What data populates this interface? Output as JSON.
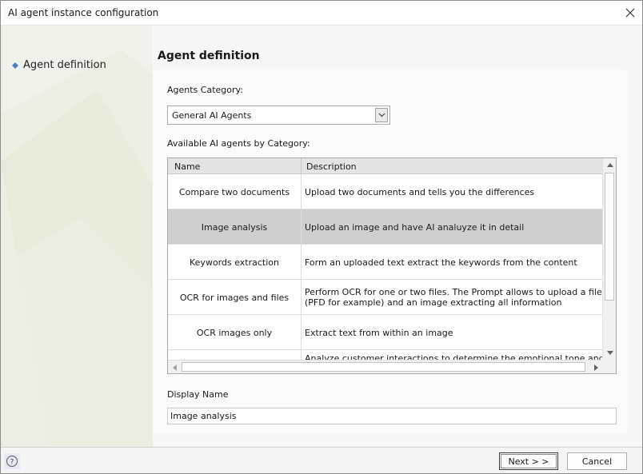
{
  "window": {
    "title": "AI agent instance configuration",
    "close_icon": "close-icon"
  },
  "sidebar": {
    "items": [
      {
        "label": "Agent definition",
        "icon": "diamond-bullet-icon",
        "active": true
      }
    ]
  },
  "main": {
    "heading": "Agent definition",
    "category_label": "Agents Category:",
    "category_value": "General AI Agents",
    "available_label": "Available AI agents by Category:",
    "table": {
      "columns": [
        "Name",
        "Description"
      ],
      "rows": [
        {
          "name": "Compare two documents",
          "description": "Upload two documents and tells you the differences",
          "selected": false
        },
        {
          "name": "Image analysis",
          "description": "Upload an image and have AI analuyze it in detail",
          "selected": true
        },
        {
          "name": "Keywords extraction",
          "description": "Form an uploaded text extract the keywords from the content",
          "selected": false
        },
        {
          "name": "OCR for images and files",
          "description": "Perform OCR for one or two files. The Prompt allows to upload a file (PFD for example) and an image extracting all information",
          "selected": false
        },
        {
          "name": "OCR images only",
          "description": "Extract text from within an image",
          "selected": false
        },
        {
          "name": "",
          "description": "Analyze customer interactions to determine the emotional tone and",
          "selected": false
        }
      ]
    },
    "display_name_label": "Display Name",
    "display_name_value": "Image analysis"
  },
  "footer": {
    "help_icon": "help-icon",
    "next_label": "Next > >",
    "cancel_label": "Cancel"
  },
  "colors": {
    "selected_row": "#cfcfcf",
    "bullet": "#4a7fc1",
    "header_bg": "#e4e4e4"
  }
}
